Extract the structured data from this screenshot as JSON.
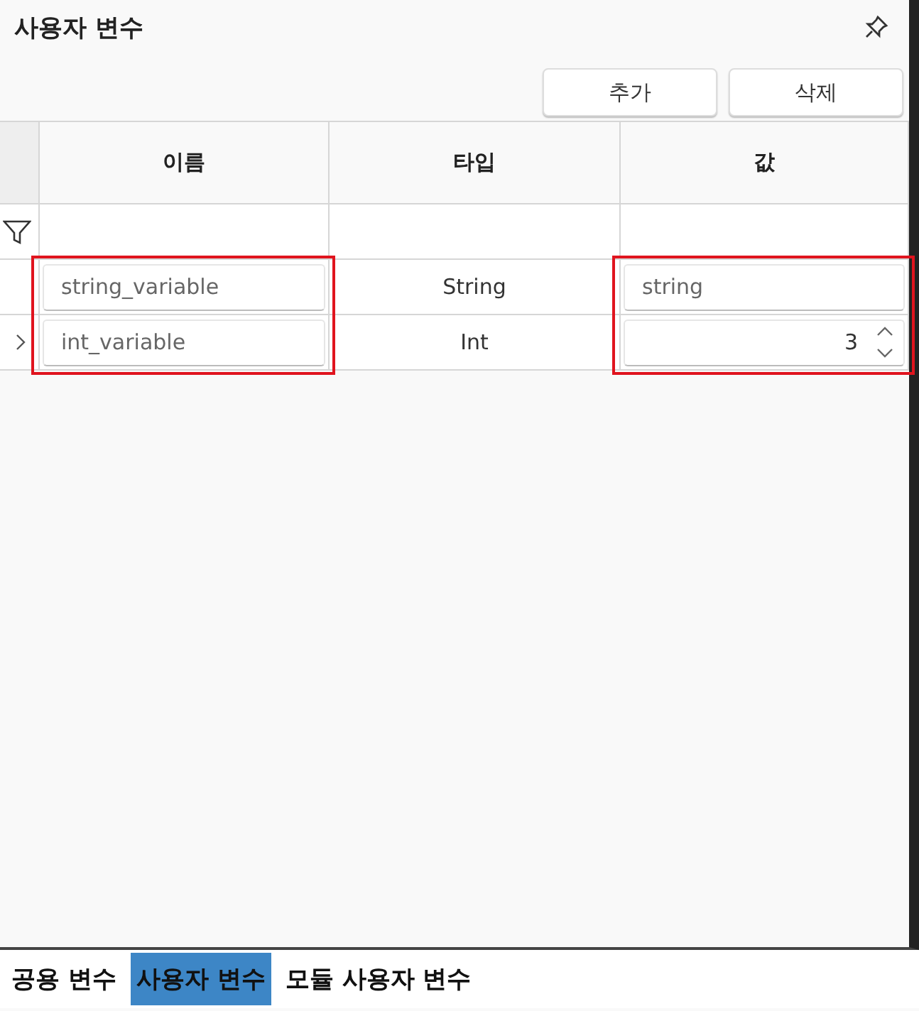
{
  "panel": {
    "title": "사용자 변수"
  },
  "toolbar": {
    "buttons": [
      "추가",
      "삭제"
    ]
  },
  "table": {
    "columns": [
      {
        "label": "이름",
        "highlighted": true
      },
      {
        "label": "타입",
        "highlighted": false
      },
      {
        "label": "값",
        "highlighted": true
      }
    ],
    "rows": [
      {
        "name": "string_variable",
        "type": "String",
        "value": {
          "kind": "text",
          "text": "string"
        },
        "expandable": false
      },
      {
        "name": "int_variable",
        "type": "Int",
        "value": {
          "kind": "number",
          "text": "3"
        },
        "expandable": true
      }
    ]
  },
  "tabs": [
    {
      "label": "공용 변수",
      "selected": false
    },
    {
      "label": "사용자 변수",
      "selected": true
    },
    {
      "label": "모듈 사용자 변수",
      "selected": false
    }
  ]
}
